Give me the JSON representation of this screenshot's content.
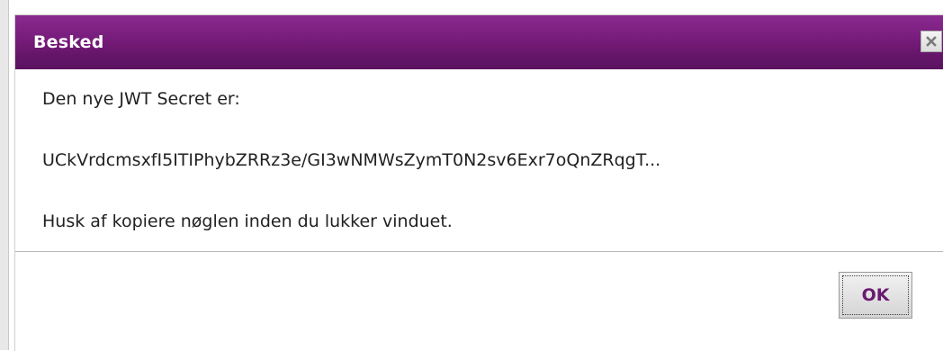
{
  "dialog": {
    "title": "Besked",
    "close_icon": "close-icon",
    "message": {
      "line1": "Den nye JWT Secret er:",
      "secret": "UCkVrdcmsxfI5ITIPhybZRRz3e/GI3wNMWsZymT0N2sv6Exr7oQnZRqgT...",
      "line3": "Husk af kopiere nøglen inden du lukker vinduet."
    },
    "ok_label": "OK"
  },
  "colors": {
    "titlebar": "#761c7b",
    "ok_text": "#6a1a70"
  }
}
